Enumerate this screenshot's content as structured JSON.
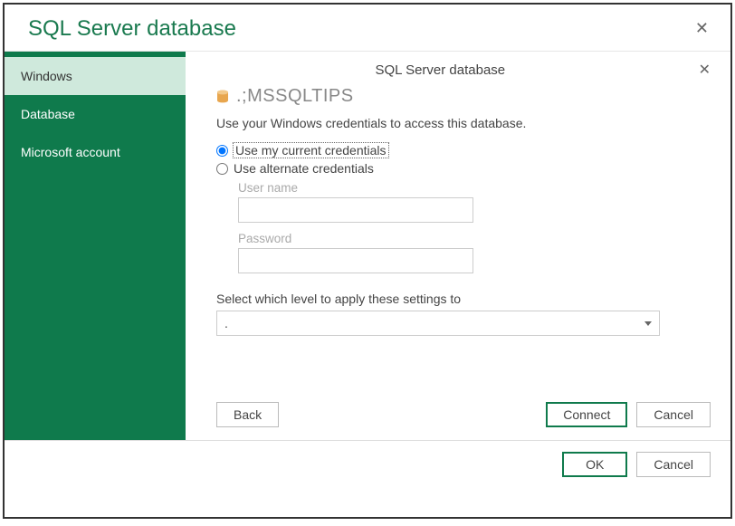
{
  "outer": {
    "title": "SQL Server database",
    "ok_label": "OK",
    "cancel_label": "Cancel"
  },
  "sidebar": {
    "items": [
      {
        "label": "Windows",
        "active": true
      },
      {
        "label": "Database",
        "active": false
      },
      {
        "label": "Microsoft account",
        "active": false
      }
    ]
  },
  "inner": {
    "title": "SQL Server database",
    "db_name": ".;MSSQLTIPS",
    "instructions": "Use your Windows credentials to access this database.",
    "radio_current": "Use my current credentials",
    "radio_alternate": "Use alternate credentials",
    "username_label": "User name",
    "username_value": "",
    "password_label": "Password",
    "password_value": "",
    "level_label": "Select which level to apply these settings to",
    "level_selected": ".",
    "back_label": "Back",
    "connect_label": "Connect",
    "cancel_label": "Cancel"
  },
  "colors": {
    "brand_green": "#0f7a4c",
    "sidebar_active": "#cfe9dc"
  }
}
